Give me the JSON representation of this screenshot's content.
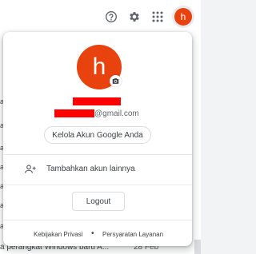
{
  "topbar": {
    "help_icon": "help-circle-icon",
    "settings_icon": "gear-icon",
    "apps_icon": "apps-grid-icon",
    "avatar_letter": "h"
  },
  "background": {
    "left_fragments": [
      "a",
      "a",
      "a",
      "a",
      "a",
      "a",
      "a"
    ],
    "bottom_subject": "a perangkat Windows baru A...",
    "bottom_date": "28 Feb"
  },
  "account_popup": {
    "avatar_letter": "h",
    "email_suffix": "@gmail.com",
    "manage_button_label": "Kelola Akun Google Anda",
    "add_account_label": "Tambahkan akun lainnya",
    "logout_label": "Logout",
    "footer": {
      "privacy_label": "Kebijakan Privasi",
      "separator": "•",
      "terms_label": "Persyaratan Layanan"
    }
  },
  "colors": {
    "avatar_bg": "#e8430f",
    "redaction": "#ff0000"
  }
}
